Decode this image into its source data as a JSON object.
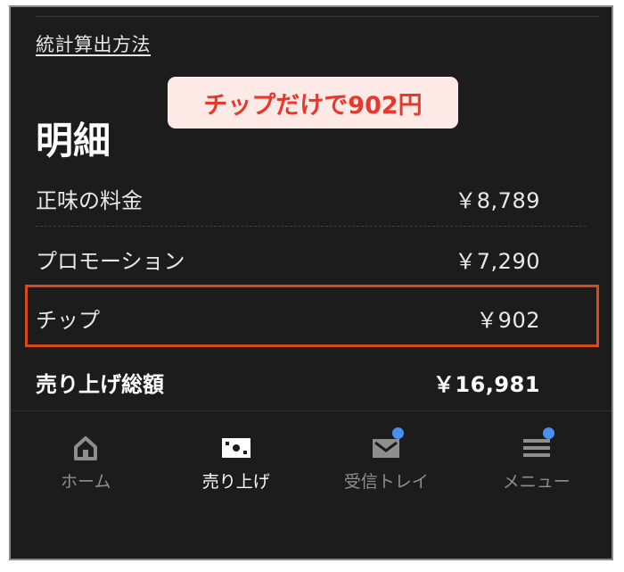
{
  "header": {
    "method_link": "統計算出方法"
  },
  "callout": {
    "text": "チップだけで902円"
  },
  "section": {
    "title": "明細"
  },
  "breakdown": [
    {
      "label": "正味の料金",
      "amount": "￥8,789"
    },
    {
      "label": "プロモーション",
      "amount": "￥7,290"
    },
    {
      "label": "チップ",
      "amount": "￥902"
    }
  ],
  "total": {
    "label": "売り上げ総額",
    "amount": "￥16,981"
  },
  "nav": {
    "items": [
      {
        "label": "ホーム",
        "icon": "home-icon",
        "active": false,
        "badge": false
      },
      {
        "label": "売り上げ",
        "icon": "earnings-icon",
        "active": true,
        "badge": false
      },
      {
        "label": "受信トレイ",
        "icon": "inbox-icon",
        "active": false,
        "badge": true
      },
      {
        "label": "メニュー",
        "icon": "menu-icon",
        "active": false,
        "badge": true
      }
    ]
  },
  "colors": {
    "background": "#1c1c1c",
    "callout_bg": "#fde9e6",
    "callout_text": "#e8382c",
    "highlight_border": "#d84a1b",
    "badge": "#4a90f0"
  }
}
